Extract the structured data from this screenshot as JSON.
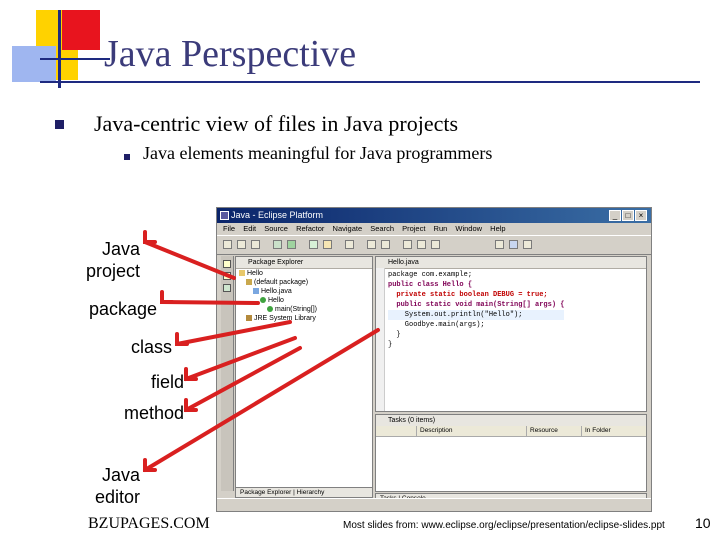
{
  "slide": {
    "title": "Java Perspective",
    "bullet_main": "Java-centric view of files in Java projects",
    "bullet_sub": "Java elements meaningful for Java programmers",
    "footer_left": "BZUPAGES.COM",
    "footer_source": "Most slides from: www.eclipse.org/eclipse/presentation/eclipse-slides.ppt",
    "page_number": "10",
    "accent_color": "#3b3b7a",
    "arrow_color": "#d92020"
  },
  "callouts": {
    "java_project": [
      "Java",
      "project"
    ],
    "package": "package",
    "class": "class",
    "field": "field",
    "method": "method",
    "java_editor": [
      "Java",
      "editor"
    ]
  },
  "eclipse": {
    "window_title": "Java - Eclipse Platform",
    "menu": [
      "File",
      "Edit",
      "Source",
      "Refactor",
      "Navigate",
      "Search",
      "Project",
      "Run",
      "Window",
      "Help"
    ],
    "package_explorer_title": "Package Explorer",
    "tree": [
      "Hello",
      "(default package)",
      "Hello.java",
      "Hello",
      "main(String[])",
      "JRE System Library"
    ],
    "package_explorer_tabs": "Package Explorer | Hierarchy",
    "editor_tab": "Hello.java",
    "code_lines": [
      "package com.example;",
      "public class Hello {",
      "  private static boolean DEBUG = true;",
      "  public static void main(String[] args) {",
      "    System.out.println(\"Hello\");",
      "    Goodbye.main(args);",
      "  }",
      "}"
    ],
    "tasks_title": "Tasks (0 items)",
    "tasks_columns": [
      "Description",
      "Resource",
      "In Folder"
    ],
    "bottom_tabs": "Tasks | Console"
  }
}
